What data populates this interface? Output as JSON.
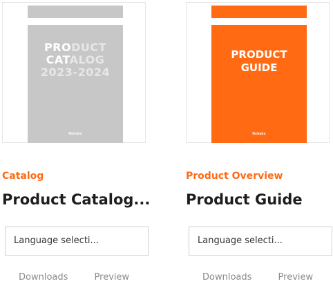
{
  "cards": [
    {
      "cover": {
        "lines_hi": "PRO",
        "line1_rest": "DUCT",
        "line2_hi": "CAT",
        "line2_rest": "ALOG",
        "line3": "2023-2024",
        "brand": "Rehabs"
      },
      "category": "Catalog",
      "title": "Product Catalog...",
      "language_placeholder": "Language selecti...",
      "links": {
        "downloads": "Downloads",
        "preview": "Preview"
      }
    },
    {
      "cover": {
        "line1": "PRODUCT",
        "line2": "GUIDE",
        "brand": "Rehabs"
      },
      "category": "Product Overview",
      "title": "Product Guide",
      "language_placeholder": "Language selecti...",
      "links": {
        "downloads": "Downloads",
        "preview": "Preview"
      }
    }
  ],
  "colors": {
    "accent": "#ff6a13",
    "grey_cover": "#c7c7c7",
    "text_dark": "#1e1e1e",
    "link_grey": "#8a8a8a"
  }
}
